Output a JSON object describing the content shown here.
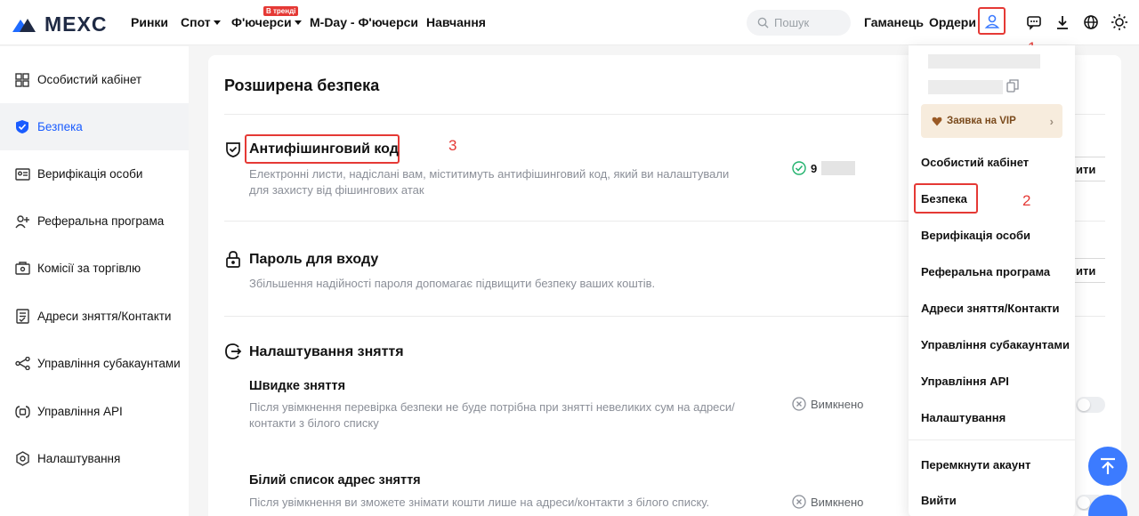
{
  "header": {
    "logo_text": "MEXC",
    "nav": [
      {
        "label": "Ринки"
      },
      {
        "label": "Спот"
      },
      {
        "label": "Ф'ючерси",
        "badge": "В тренді"
      },
      {
        "label": "M-Day - Ф'ючерси"
      },
      {
        "label": "Навчання"
      }
    ],
    "search_placeholder": "Пошук",
    "wallet_label": "Гаманець",
    "orders_label": "Ордери"
  },
  "markers": {
    "one": "1",
    "two": "2",
    "three": "3"
  },
  "sidebar": {
    "items": [
      {
        "label": "Особистий кабінет",
        "icon": "dashboard-icon"
      },
      {
        "label": "Безпека",
        "icon": "shield-icon",
        "active": true
      },
      {
        "label": "Верифікація особи",
        "icon": "id-card-icon"
      },
      {
        "label": "Реферальна програма",
        "icon": "add-user-icon"
      },
      {
        "label": "Комісії за торгівлю",
        "icon": "fee-icon"
      },
      {
        "label": "Адреси зняття/Контакти",
        "icon": "address-book-icon"
      },
      {
        "label": "Управління субакаунтами",
        "icon": "subaccount-icon"
      },
      {
        "label": "Управління API",
        "icon": "api-icon"
      },
      {
        "label": "Налаштування",
        "icon": "settings-icon"
      }
    ]
  },
  "main": {
    "title": "Розширена безпека",
    "anti_phishing": {
      "title": "Антифішинговий код",
      "desc": "Електронні листи, надіслані вам, міститимуть антифішинговий код, який ви налаштували для захисту від фішингових атак",
      "status_prefix": "9",
      "button_label": "ити"
    },
    "login_password": {
      "title": "Пароль для входу",
      "desc": "Збільшення надійності пароля допомагає підвищити безпеку ваших коштів.",
      "button_label": "ити"
    },
    "withdraw_settings": {
      "title": "Налаштування зняття",
      "quick": {
        "title": "Швидке зняття",
        "desc": "Після увімкнення перевірка безпеки не буде потрібна при знятті невеликих сум на адреси/контакти з білого списку",
        "status": "Вимкнено"
      },
      "whitelist": {
        "title": "Білий список адрес зняття",
        "desc": "Після увімкнення ви зможете знімати кошти лише на адреси/контакти з білого списку.",
        "status": "Вимкнено"
      }
    }
  },
  "dropdown": {
    "vip_label": "Заявка на VIP",
    "items": [
      {
        "label": "Особистий кабінет"
      },
      {
        "label": "Безпека"
      },
      {
        "label": "Верифікація особи"
      },
      {
        "label": "Реферальна програма"
      },
      {
        "label": "Адреси зняття/Контакти"
      },
      {
        "label": "Управління субакаунтами"
      },
      {
        "label": "Управління API"
      },
      {
        "label": "Налаштування"
      }
    ],
    "switch_account": "Перемкнути акаунт",
    "logout": "Вийти"
  },
  "colors": {
    "accent": "#1a5cff",
    "annotation": "#e53935",
    "brand": "#1f2a44"
  }
}
